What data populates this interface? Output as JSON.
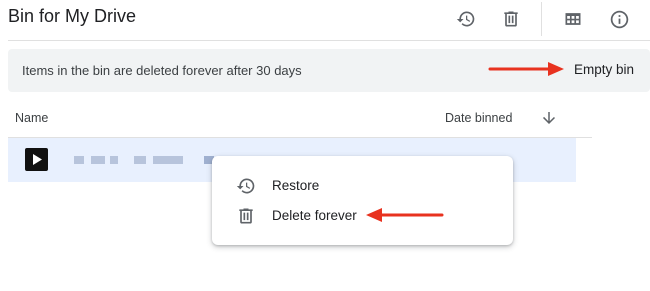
{
  "header": {
    "title": "Bin for My Drive",
    "icons": [
      "history-icon",
      "trash-icon",
      "grid-view-icon",
      "info-icon"
    ]
  },
  "banner": {
    "message": "Items in the bin are deleted forever after 30 days",
    "empty_bin_label": "Empty bin"
  },
  "table": {
    "columns": {
      "name": "Name",
      "date_binned": "Date binned"
    },
    "sort_direction": "descending"
  },
  "context_menu": {
    "items": [
      {
        "label": "Restore",
        "icon": "restore-icon"
      },
      {
        "label": "Delete forever",
        "icon": "trash-icon"
      }
    ]
  },
  "colors": {
    "selected_row": "#e8f0fe",
    "banner_bg": "#f1f3f4",
    "annotation_arrow": "#e8321f",
    "icon": "#5f6368"
  }
}
